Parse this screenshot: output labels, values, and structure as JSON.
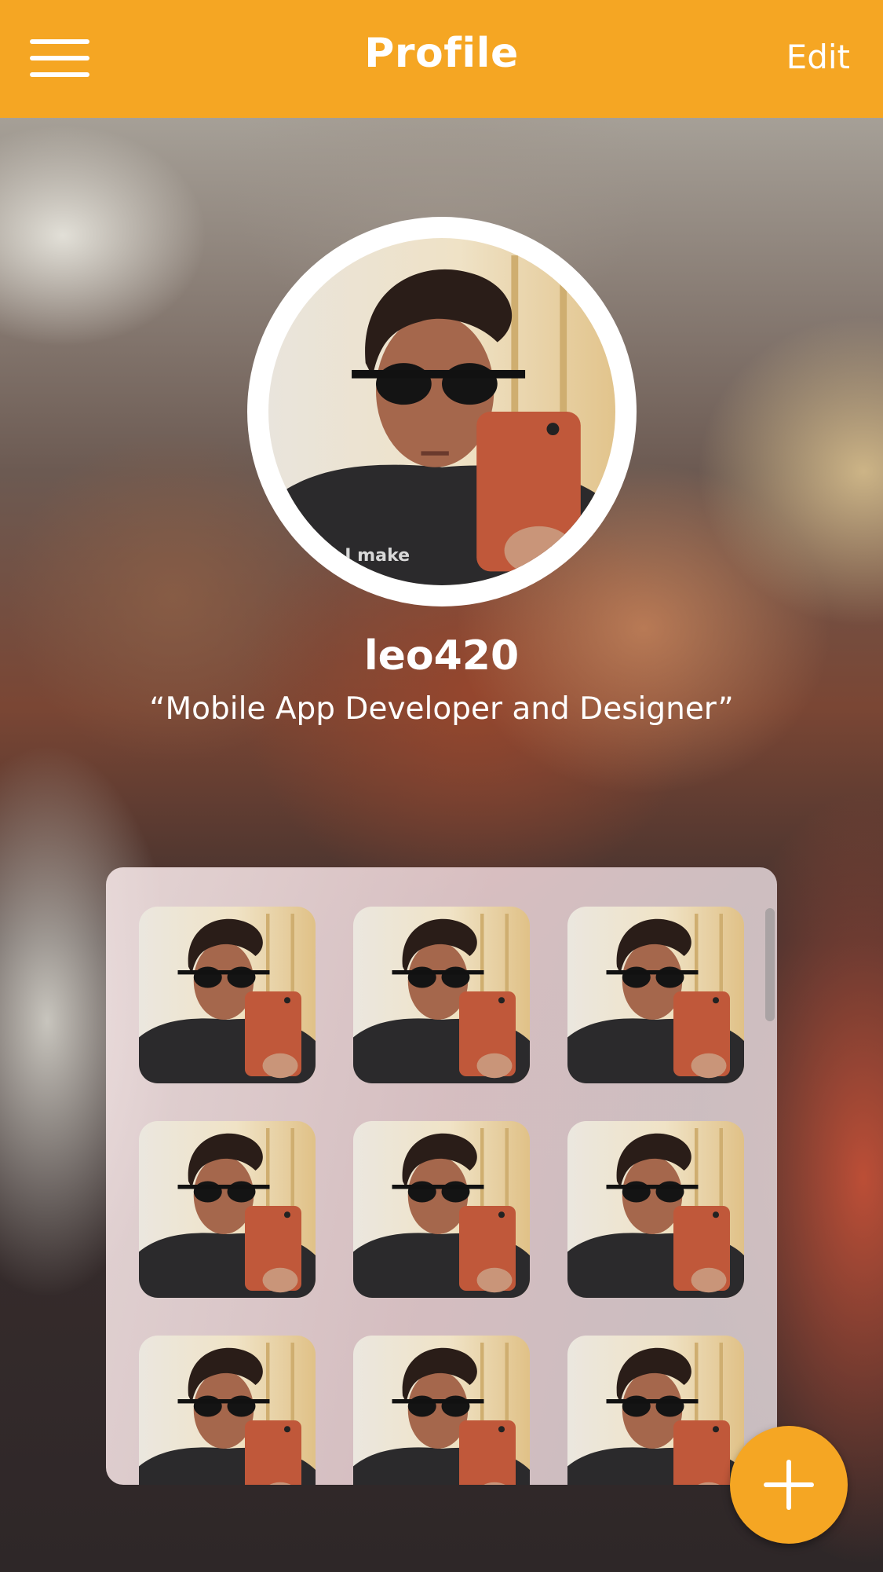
{
  "header": {
    "title": "Profile",
    "edit_label": "Edit",
    "menu_icon": "hamburger-menu-icon",
    "color": "#f5a623"
  },
  "profile": {
    "username": "leo420",
    "bio": "“Mobile App Developer and Designer”",
    "shirt_text": "I make"
  },
  "photos": {
    "count_visible": 9,
    "columns": 3
  },
  "fab": {
    "icon": "plus-icon",
    "color": "#f5a623"
  }
}
